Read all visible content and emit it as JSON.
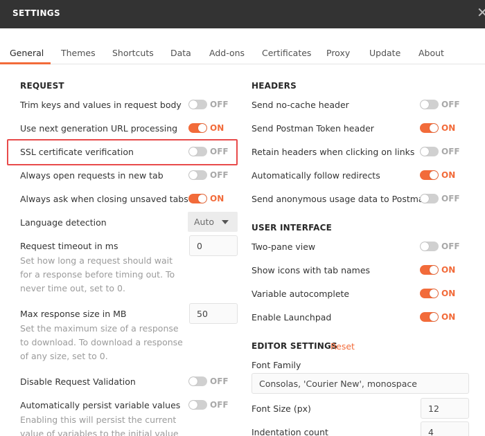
{
  "window": {
    "title": "SETTINGS",
    "close_glyph": "✕"
  },
  "tabs": [
    {
      "label": "General",
      "active": true
    },
    {
      "label": "Themes"
    },
    {
      "label": "Shortcuts"
    },
    {
      "label": "Data"
    },
    {
      "label": "Add-ons"
    },
    {
      "label": "Certificates"
    },
    {
      "label": "Proxy"
    },
    {
      "label": "Update"
    },
    {
      "label": "About"
    }
  ],
  "request": {
    "heading": "REQUEST",
    "trim_keys": {
      "label": "Trim keys and values in request body",
      "state": "OFF"
    },
    "next_gen_url": {
      "label": "Use next generation URL processing",
      "state": "ON"
    },
    "ssl_verification": {
      "label": "SSL certificate verification",
      "state": "OFF"
    },
    "open_new_tab": {
      "label": "Always open requests in new tab",
      "state": "OFF"
    },
    "ask_closing": {
      "label": "Always ask when closing unsaved tabs",
      "state": "ON"
    },
    "language_detection": {
      "label": "Language detection",
      "value": "Auto"
    },
    "timeout": {
      "label": "Request timeout in ms",
      "value": "0",
      "description": "Set how long a request should wait for a response before timing out. To never time out, set to 0."
    },
    "max_response": {
      "label": "Max response size in MB",
      "value": "50",
      "description": "Set the maximum size of a response to download. To download a response of any size, set to 0."
    },
    "disable_validation": {
      "label": "Disable Request Validation",
      "state": "OFF"
    },
    "persist_variables": {
      "label": "Automatically persist variable values",
      "state": "OFF",
      "description": "Enabling this will persist the current value of variables to the initial value at"
    }
  },
  "headers": {
    "heading": "HEADERS",
    "no_cache": {
      "label": "Send no-cache header",
      "state": "OFF"
    },
    "postman_token": {
      "label": "Send Postman Token header",
      "state": "ON"
    },
    "retain_headers": {
      "label": "Retain headers when clicking on links",
      "state": "OFF"
    },
    "follow_redirects": {
      "label": "Automatically follow redirects",
      "state": "ON"
    },
    "usage_data": {
      "label": "Send anonymous usage data to Postman",
      "state": "OFF"
    }
  },
  "user_interface": {
    "heading": "USER INTERFACE",
    "two_pane": {
      "label": "Two-pane view",
      "state": "OFF"
    },
    "tab_icons": {
      "label": "Show icons with tab names",
      "state": "ON"
    },
    "var_autocomplete": {
      "label": "Variable autocomplete",
      "state": "ON"
    },
    "launchpad": {
      "label": "Enable Launchpad",
      "state": "ON"
    }
  },
  "editor": {
    "heading": "EDITOR SETTINGS",
    "reset_label": "Reset",
    "font_family": {
      "label": "Font Family",
      "value": "Consolas, 'Courier New', monospace"
    },
    "font_size": {
      "label": "Font Size (px)",
      "value": "12"
    },
    "indentation": {
      "label": "Indentation count",
      "value": "4"
    }
  },
  "colors": {
    "accent": "#f26b3a",
    "titlebar": "#333333",
    "highlight": "#e84a4a",
    "toggle_off": "#d0d0d0"
  }
}
